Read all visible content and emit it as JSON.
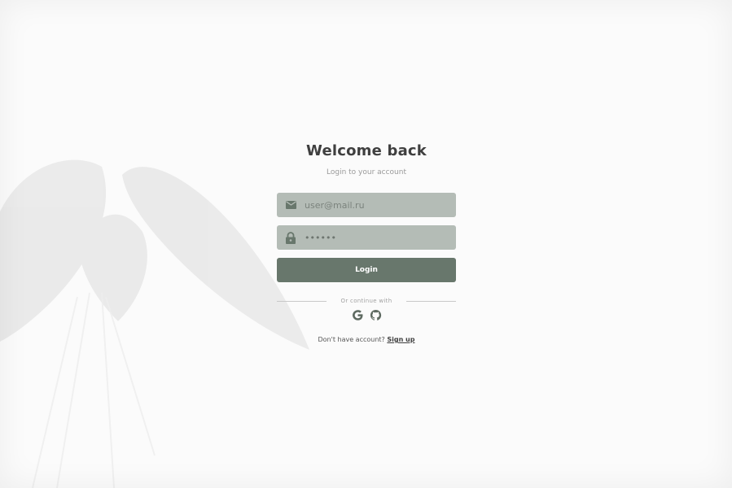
{
  "login": {
    "title": "Welcome back",
    "subtitle": "Login to your account",
    "email": {
      "placeholder": "user@mail.ru",
      "icon": "mail-icon"
    },
    "password": {
      "value": "******",
      "icon": "lock-icon"
    },
    "submit_label": "Login",
    "divider_text": "Or continue with",
    "social": [
      {
        "name": "google",
        "icon": "google-icon"
      },
      {
        "name": "github",
        "icon": "github-icon"
      }
    ],
    "signup_prompt": "Don't have account?",
    "signup_link": "Sign up"
  },
  "colors": {
    "background": "#fbfbfb",
    "field": "#b4bcb6",
    "button": "#68776c",
    "title": "#3f3f3f",
    "icon": "#68776c"
  }
}
